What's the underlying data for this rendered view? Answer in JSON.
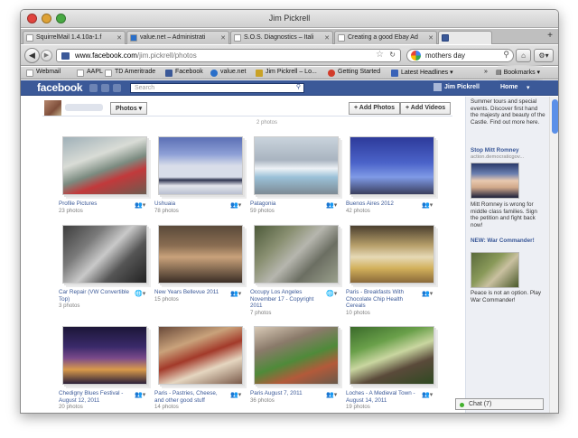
{
  "window": {
    "title": "Jim Pickrell"
  },
  "tabs": [
    {
      "label": "SquirrelMail 1.4.10a-1.f",
      "active": false
    },
    {
      "label": "value.net – Administrati",
      "active": false
    },
    {
      "label": "S.O.S. Diagnostics – Itali",
      "active": false
    },
    {
      "label": "Creating a good Ebay Ad",
      "active": false
    },
    {
      "label": "",
      "active": true
    }
  ],
  "navbar": {
    "url_domain": "www.facebook.com",
    "url_path": "/jim.pickrell/photos",
    "search_value": "mothers day"
  },
  "bookmarks": [
    "Webmail",
    "AAPL",
    "TD Ameritrade",
    "Facebook",
    "value.net",
    "Jim Pickrell – Lo...",
    "Getting Started",
    "Latest Headlines ▾"
  ],
  "bookmarks_menu": "Bookmarks ▾",
  "facebook": {
    "logo": "facebook",
    "search_placeholder": "Search",
    "user_name": "Jim Pickrell",
    "home_label": "Home"
  },
  "photos_header": {
    "photos_dropdown": "Photos ▾",
    "add_photos": "+ Add Photos",
    "add_videos": "+ Add Videos",
    "count_stub": "2 photos"
  },
  "albums": [
    {
      "title": "Profile Pictures",
      "count": "23 photos",
      "privacy": "friends"
    },
    {
      "title": "Ushuaia",
      "count": "78 photos",
      "privacy": "friends"
    },
    {
      "title": "Patagonia",
      "count": "59 photos",
      "privacy": "friends"
    },
    {
      "title": "Buenos Aires 2012",
      "count": "42 photos",
      "privacy": "friends"
    },
    {
      "title": "Car Repair (VW Convertible Top)",
      "count": "3 photos",
      "privacy": "public"
    },
    {
      "title": "New Years Bellevue 2011",
      "count": "15 photos",
      "privacy": "friends"
    },
    {
      "title": "Occupy Los Angeles November 17 - Copyright 2011",
      "count": "7 photos",
      "privacy": "public"
    },
    {
      "title": "Paris - Breakfasts With Chocolate Chip Health Cereals",
      "count": "10 photos",
      "privacy": "friends"
    },
    {
      "title": "Chedigny Blues Festival - August 12, 2011",
      "count": "20 photos",
      "privacy": "friends"
    },
    {
      "title": "Paris - Pastries, Cheese, and other good stuff",
      "count": "14 photos",
      "privacy": "friends"
    },
    {
      "title": "Paris August 7, 2011",
      "count": "36 photos",
      "privacy": "friends"
    },
    {
      "title": "Loches - A Medieval Town - August 14, 2011",
      "count": "19 photos",
      "privacy": "friends"
    }
  ],
  "sidebar": {
    "ad1_text": "Summer tours and special events. Discover first hand the majesty and beauty of the Castle. Find out more here.",
    "ad2_title": "Stop Mitt Romney",
    "ad2_sub": "action.democraticgov...",
    "ad2_text": "Mitt Romney is wrong for middle class families. Sign the petition and fight back now!",
    "ad3_title": "NEW: War Commander!",
    "ad3_text": "Peace is not an option. Play War Commander!"
  },
  "chat": {
    "label": "Chat (7)"
  }
}
